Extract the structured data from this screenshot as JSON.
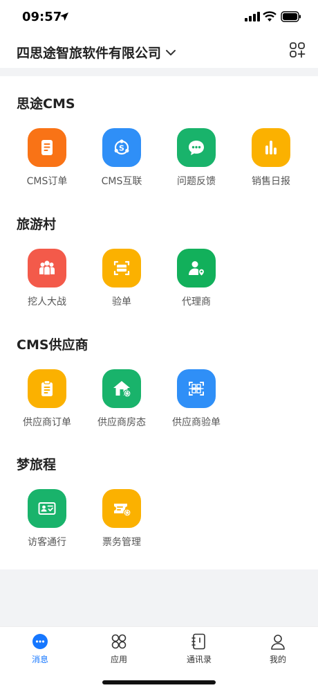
{
  "status": {
    "time": "09:57"
  },
  "header": {
    "company": "四思途智旅软件有限公司"
  },
  "sections": [
    {
      "title": "思途CMS",
      "items": [
        {
          "label": "CMS订单",
          "color": "#f97316",
          "icon": "document-icon"
        },
        {
          "label": "CMS互联",
          "color": "#2f8ff7",
          "icon": "link-icon"
        },
        {
          "label": "问题反馈",
          "color": "#19b36b",
          "icon": "chat-icon"
        },
        {
          "label": "销售日报",
          "color": "#fbb100",
          "icon": "bar-chart-icon"
        }
      ]
    },
    {
      "title": "旅游村",
      "items": [
        {
          "label": "挖人大战",
          "color": "#f35a4a",
          "icon": "people-icon"
        },
        {
          "label": "验单",
          "color": "#fbb100",
          "icon": "scan-icon"
        },
        {
          "label": "代理商",
          "color": "#12b05b",
          "icon": "agent-icon"
        }
      ]
    },
    {
      "title": "CMS供应商",
      "items": [
        {
          "label": "供应商订单",
          "color": "#fbb100",
          "icon": "clipboard-icon"
        },
        {
          "label": "供应商房态",
          "color": "#19b36b",
          "icon": "house-gear-icon"
        },
        {
          "label": "供应商验单",
          "color": "#2f8ff7",
          "icon": "qr-scan-icon"
        }
      ]
    },
    {
      "title": "梦旅程",
      "items": [
        {
          "label": "访客通行",
          "color": "#19b36b",
          "icon": "id-card-icon"
        },
        {
          "label": "票务管理",
          "color": "#fbb100",
          "icon": "ticket-gear-icon"
        }
      ]
    }
  ],
  "tabs": [
    {
      "label": "消息",
      "active": true,
      "icon": "message-icon"
    },
    {
      "label": "应用",
      "active": false,
      "icon": "apps-icon"
    },
    {
      "label": "通讯录",
      "active": false,
      "icon": "contacts-icon"
    },
    {
      "label": "我的",
      "active": false,
      "icon": "profile-icon"
    }
  ],
  "colors": {
    "accent": "#1677ff"
  }
}
